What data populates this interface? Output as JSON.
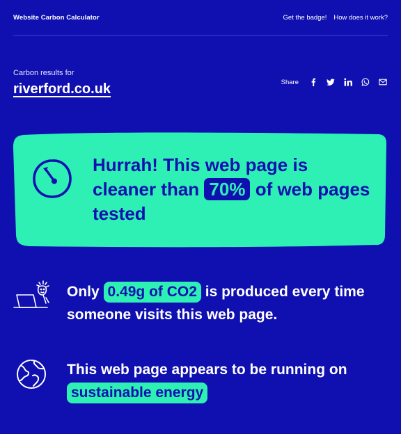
{
  "header": {
    "brand": "Website Carbon Calculator",
    "nav": [
      "Get the badge!",
      "How does it work?"
    ]
  },
  "results": {
    "label": "Carbon results for",
    "url": "riverford.co.uk"
  },
  "share": {
    "label": "Share",
    "icons": [
      "facebook-icon",
      "twitter-icon",
      "linkedin-icon",
      "whatsapp-icon",
      "email-icon"
    ]
  },
  "hero": {
    "text_before": "Hurrah! This web page is cleaner than",
    "percent": "70%",
    "text_after": "of web pages tested",
    "icon": "gauge-icon"
  },
  "co2": {
    "before": "Only",
    "amount": "0.49g of CO2",
    "after": "is produced every time someone visits this web page.",
    "icon": "person-laptop-icon"
  },
  "energy": {
    "before": "This web page appears to be running on",
    "highlight": "sustainable energy",
    "icon": "globe-icon"
  },
  "colors": {
    "background": "#1010b0",
    "accent": "#2ef0b4",
    "text": "#ffffff"
  }
}
